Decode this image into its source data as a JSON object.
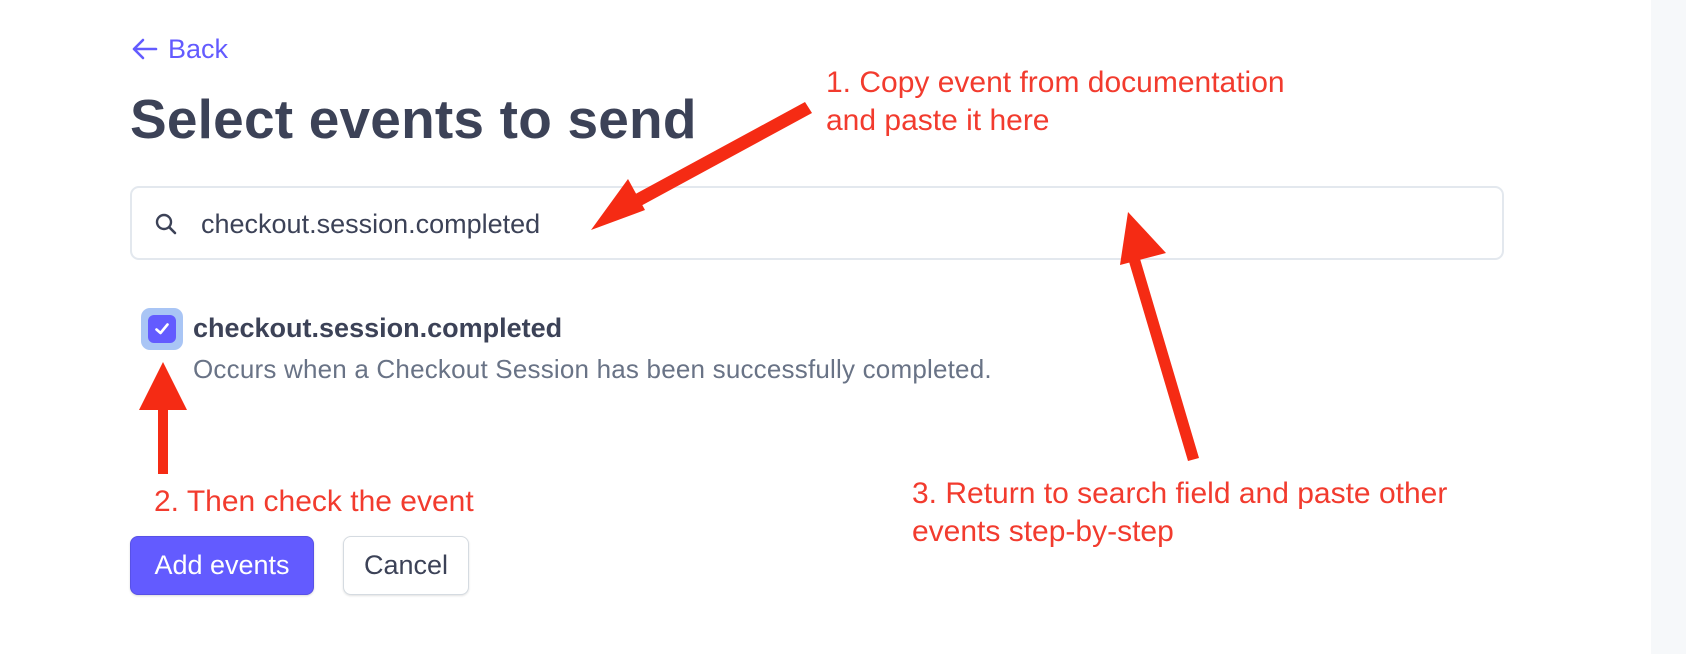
{
  "nav": {
    "back_label": "Back",
    "back_icon": "arrow-left-icon"
  },
  "page": {
    "title": "Select events to send"
  },
  "search": {
    "value": "checkout.session.completed",
    "icon": "search-icon"
  },
  "events": [
    {
      "name": "checkout.session.completed",
      "description": "Occurs when a Checkout Session has been successfully completed.",
      "checked": true
    }
  ],
  "actions": {
    "add_label": "Add events",
    "cancel_label": "Cancel"
  },
  "annotations": {
    "step1": [
      "1. Copy event from documentation",
      "and paste it here"
    ],
    "step2": "2. Then check the event",
    "step3": [
      "3. Return to search field and paste other",
      "events step-by-step"
    ]
  },
  "colors": {
    "accent": "#635bff",
    "title_text": "#3c4257",
    "muted_text": "#697386",
    "annotation": "#f23b2e",
    "checkbox_focus_ring": "#a9c5f5"
  }
}
